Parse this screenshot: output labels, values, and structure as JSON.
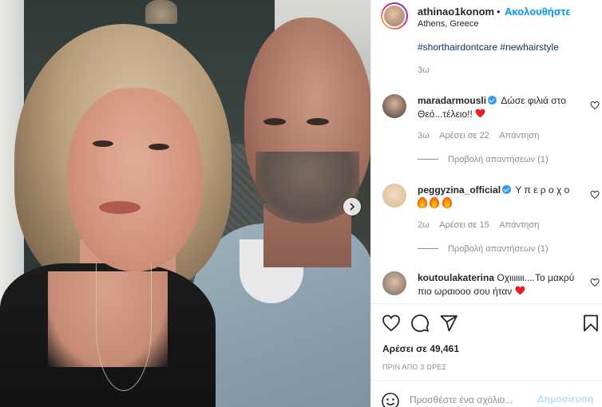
{
  "header": {
    "username": "athinao1konoma",
    "separator": "•",
    "follow_label": "Ακολουθήστε",
    "location": "Athens, Greece"
  },
  "caption": {
    "hashtags": [
      "#shorthairdontcare",
      "#newhairstyle"
    ],
    "time": "3ω"
  },
  "comments": [
    {
      "username": "maradarmousli",
      "verified": true,
      "text": "Δώσε φιλιά στο Θεό...τέλειο!!",
      "emoji": "red-heart",
      "time": "3ω",
      "likes": "Αρέσει σε 22",
      "reply_label": "Απάντηση",
      "view_replies": "Προβολή απαντήσεων (1)"
    },
    {
      "username": "peggyzina_official",
      "verified": true,
      "text": "Υ π ε ρ ο χ ο",
      "emoji": "fire x3",
      "time": "2ω",
      "likes": "Αρέσει σε 15",
      "reply_label": "Απάντηση",
      "view_replies": "Προβολή απαντήσεων (1)"
    },
    {
      "username": "koutoulakaterina",
      "verified": false,
      "text": "Οχιιιιιιι....Το μακρύ πιο ωραιοοο σου ήταν",
      "emoji": "red-heart"
    }
  ],
  "likes_total": "Αρέσει σε 49,461",
  "post_date": "ΠΡΙΝ ΑΠΟ 3 ΩΡΕΣ",
  "add_comment": {
    "placeholder": "Προσθέστε ένα σχόλιο...",
    "post_label": "Δημοσίευση"
  },
  "icons": {
    "like": "heart-icon",
    "comment": "comment-icon",
    "share": "send-icon",
    "save": "bookmark-icon",
    "emoji": "smiley-icon",
    "next": "chevron-right-icon"
  },
  "colors": {
    "accent": "#0095f6",
    "link": "#00376b",
    "muted": "#8e8e8e",
    "heart": "#ed4956",
    "post_disabled": "#b2dffc"
  }
}
